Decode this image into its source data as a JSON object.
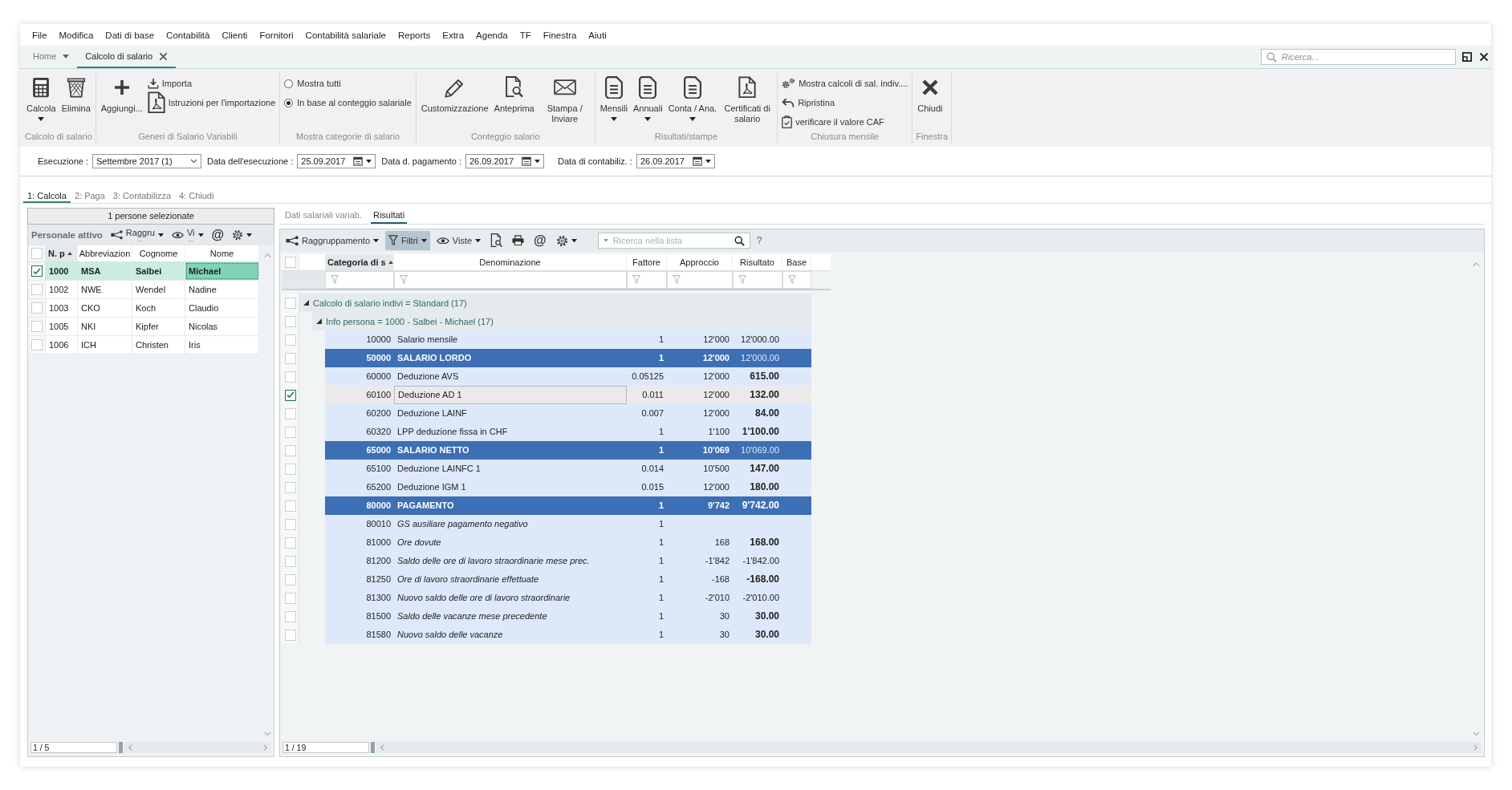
{
  "menu": [
    "File",
    "Modifica",
    "Dati di base",
    "Contabilità",
    "Clienti",
    "Fornitori",
    "Contabilità salariale",
    "Reports",
    "Extra",
    "Agenda",
    "TF",
    "Finestra",
    "Aiuti"
  ],
  "tabs": [
    {
      "label": "Home",
      "selected": false,
      "dropdown": true,
      "closable": false
    },
    {
      "label": "Calcolo di salario",
      "selected": true,
      "dropdown": false,
      "closable": true
    }
  ],
  "search": {
    "placeholder": "Ricerca..."
  },
  "ribbon": [
    {
      "title": "Calcolo di salario",
      "items": [
        {
          "kind": "large",
          "label": "Calcola",
          "dropdown": true
        },
        {
          "kind": "large",
          "label": "Elimina",
          "dropdown": false
        }
      ]
    },
    {
      "title": "Generi di Salario Variabili",
      "items": [
        {
          "kind": "large",
          "label": "Aggiungi...",
          "dropdown": false
        },
        {
          "kind": "small",
          "label": "Importa"
        },
        {
          "kind": "small",
          "label": "Istruzioni per l'importazione"
        }
      ]
    },
    {
      "title": "Mostra categorie di salario",
      "items": [
        {
          "kind": "radio",
          "label": "Mostra tutti",
          "selected": false
        },
        {
          "kind": "radio",
          "label": "In base al conteggio salariale",
          "selected": true
        }
      ]
    },
    {
      "title": "Conteggio salario",
      "items": [
        {
          "kind": "large",
          "label": "Customizzazione",
          "dropdown": false
        },
        {
          "kind": "large",
          "label": "Anteprima",
          "dropdown": false
        },
        {
          "kind": "large",
          "label": "Stampa / Inviare",
          "dropdown": false
        }
      ]
    },
    {
      "title": "Risultati/stampe",
      "items": [
        {
          "kind": "large",
          "label": "Mensili",
          "dropdown": true
        },
        {
          "kind": "large",
          "label": "Annuali",
          "dropdown": true
        },
        {
          "kind": "large",
          "label": "Conta / Ana.",
          "dropdown": true
        },
        {
          "kind": "large",
          "label": "Certificati di salario",
          "dropdown": false
        }
      ]
    },
    {
      "title": "Chiusura mensile",
      "items": [
        {
          "kind": "small",
          "label": "Mostra calcoli di sal. indiv...."
        },
        {
          "kind": "small",
          "label": "Ripristina"
        },
        {
          "kind": "small",
          "label": "verificare il valore CAF"
        }
      ]
    },
    {
      "title": "Finestra",
      "items": [
        {
          "kind": "large",
          "label": "Chiudi",
          "dropdown": false
        }
      ]
    }
  ],
  "run_fields": [
    {
      "kind": "select",
      "label": "Esecuzione :",
      "value": "Settembre 2017 (1)"
    },
    {
      "kind": "date",
      "label": "Data dell'esecuzione :",
      "value": "25.09.2017"
    },
    {
      "kind": "date",
      "label": "Data d. pagamento :",
      "value": "26.09.2017"
    },
    {
      "kind": "date",
      "label": "Data di contabiliz. :",
      "value": "26.09.2017"
    }
  ],
  "steps": [
    {
      "label": "1: Calcola",
      "selected": true
    },
    {
      "label": "2: Paga",
      "selected": false
    },
    {
      "label": "3: Contabilizza",
      "selected": false
    },
    {
      "label": "4: Chiudi",
      "selected": false
    }
  ],
  "people_panel": {
    "header": "1 persone selezionate",
    "title": "Personale attivo",
    "tools": [
      {
        "kind": "menu",
        "label": "Raggru",
        "more": "...",
        "dropdown": true
      },
      {
        "kind": "menu",
        "label": "Vi",
        "more": "...",
        "dropdown": true
      },
      {
        "kind": "glyph",
        "label": "@",
        "dropdown": false
      },
      {
        "kind": "icon",
        "dropdown": true
      }
    ],
    "all_checked": false,
    "columns": [
      {
        "label": "N. p",
        "sorted": true
      },
      {
        "label": "Abbreviazion",
        "sorted": false
      },
      {
        "label": "Cognome",
        "sorted": false
      },
      {
        "label": "Nome",
        "sorted": false
      }
    ],
    "rows": [
      {
        "number": "1000",
        "abbreviation": "MSA",
        "last_name": "Salbei",
        "first_name": "Michael",
        "checked": true,
        "selected": true
      },
      {
        "number": "1002",
        "abbreviation": "NWE",
        "last_name": "Wendel",
        "first_name": "Nadine",
        "checked": false,
        "selected": false
      },
      {
        "number": "1003",
        "abbreviation": "CKO",
        "last_name": "Koch",
        "first_name": "Claudio",
        "checked": false,
        "selected": false
      },
      {
        "number": "1005",
        "abbreviation": "NKI",
        "last_name": "Kipfer",
        "first_name": "Nicolas",
        "checked": false,
        "selected": false
      },
      {
        "number": "1006",
        "abbreviation": "ICH",
        "last_name": "Christen",
        "first_name": "Iris",
        "checked": false,
        "selected": false
      }
    ],
    "counter": "1 / 5"
  },
  "results_panel": {
    "subtabs": [
      {
        "label": "Dati salariali variab.",
        "selected": false
      },
      {
        "label": "Risultati",
        "selected": true
      }
    ],
    "toolbar": [
      {
        "kind": "menu",
        "label": "Raggruppamento",
        "dropdown": true,
        "pressed": false
      },
      {
        "kind": "menu",
        "label": "Filtri",
        "dropdown": true,
        "pressed": true
      },
      {
        "kind": "menu",
        "label": "Viste",
        "dropdown": true,
        "pressed": false
      },
      {
        "kind": "icon",
        "dropdown": false,
        "pressed": false
      },
      {
        "kind": "icon",
        "dropdown": false,
        "pressed": false
      },
      {
        "kind": "glyph",
        "label": "@",
        "dropdown": false,
        "pressed": false
      },
      {
        "kind": "icon",
        "dropdown": true,
        "pressed": false
      }
    ],
    "search": {
      "placeholder": "Ricerca nella lista"
    },
    "help": "?",
    "all_checked": false,
    "columns": [
      {
        "label": "Categoria di s",
        "sorted": true
      },
      {
        "label": "Denominazione",
        "sorted": false
      },
      {
        "label": "Fattore",
        "sorted": false
      },
      {
        "label": "Approccio",
        "sorted": false
      },
      {
        "label": "Risultato",
        "sorted": false
      },
      {
        "label": "Base",
        "sorted": false
      }
    ],
    "tree": [
      {
        "kind": "group",
        "label": "Calcolo di salario indivi = Standard (17)",
        "expanded": true,
        "checked": false,
        "children": [
          {
            "kind": "group",
            "label": "Info persona = 1000 - Salbei - Michael (17)",
            "expanded": true,
            "checked": false,
            "children": [
              {
                "kind": "line",
                "code": "10000",
                "name": "Salario mensile",
                "fattore": "1",
                "approccio": "12'000",
                "risultato": "12'000.00",
                "result_bold": false,
                "italic": false,
                "checked": false,
                "selected": false
              },
              {
                "kind": "total",
                "code": "50000",
                "name": "SALARIO LORDO",
                "fattore": "1",
                "approccio": "12'000",
                "risultato": "12'000.00",
                "result_bold": false,
                "italic": false,
                "checked": false,
                "selected": false
              },
              {
                "kind": "line",
                "code": "60000",
                "name": "Deduzione AVS",
                "fattore": "0.05125",
                "approccio": "12'000",
                "risultato": "615.00",
                "result_bold": true,
                "italic": false,
                "checked": false,
                "selected": false
              },
              {
                "kind": "line",
                "code": "60100",
                "name": "Deduzione AD 1",
                "fattore": "0.011",
                "approccio": "12'000",
                "risultato": "132.00",
                "result_bold": true,
                "italic": false,
                "checked": true,
                "selected": true
              },
              {
                "kind": "line",
                "code": "60200",
                "name": "Deduzione LAINF",
                "fattore": "0.007",
                "approccio": "12'000",
                "risultato": "84.00",
                "result_bold": true,
                "italic": false,
                "checked": false,
                "selected": false
              },
              {
                "kind": "line",
                "code": "60320",
                "name": "LPP deduzione fissa in CHF",
                "fattore": "1",
                "approccio": "1'100",
                "risultato": "1'100.00",
                "result_bold": true,
                "italic": false,
                "checked": false,
                "selected": false
              },
              {
                "kind": "total",
                "code": "65000",
                "name": "SALARIO NETTO",
                "fattore": "1",
                "approccio": "10'069",
                "risultato": "10'069.00",
                "result_bold": false,
                "italic": false,
                "checked": false,
                "selected": false
              },
              {
                "kind": "line",
                "code": "65100",
                "name": "Deduzione LAINFC 1",
                "fattore": "0.014",
                "approccio": "10'500",
                "risultato": "147.00",
                "result_bold": true,
                "italic": false,
                "checked": false,
                "selected": false
              },
              {
                "kind": "line",
                "code": "65200",
                "name": "Deduzione IGM 1",
                "fattore": "0.015",
                "approccio": "12'000",
                "risultato": "180.00",
                "result_bold": true,
                "italic": false,
                "checked": false,
                "selected": false
              },
              {
                "kind": "total",
                "code": "80000",
                "name": "PAGAMENTO",
                "fattore": "1",
                "approccio": "9'742",
                "risultato": "9'742.00",
                "result_bold": true,
                "italic": false,
                "checked": false,
                "selected": false
              },
              {
                "kind": "line",
                "code": "80010",
                "name": "GS ausiliare pagamento negativo",
                "fattore": "1",
                "italic": true,
                "checked": false,
                "selected": false
              },
              {
                "kind": "line",
                "code": "81000",
                "name": "Ore dovute",
                "fattore": "1",
                "approccio": "168",
                "risultato": "168.00",
                "result_bold": true,
                "italic": true,
                "checked": false,
                "selected": false
              },
              {
                "kind": "line",
                "code": "81200",
                "name": "Saldo delle ore di lavoro straordinarie mese prec.",
                "fattore": "1",
                "approccio": "-1'842",
                "risultato": "-1'842.00",
                "result_bold": false,
                "italic": true,
                "checked": false,
                "selected": false
              },
              {
                "kind": "line",
                "code": "81250",
                "name": "Ore di lavoro straordinarie effettuate",
                "fattore": "1",
                "approccio": "-168",
                "risultato": "-168.00",
                "result_bold": true,
                "italic": true,
                "checked": false,
                "selected": false
              },
              {
                "kind": "line",
                "code": "81300",
                "name": "Nuovo saldo delle ore di lavoro straordinarie",
                "fattore": "1",
                "approccio": "-2'010",
                "risultato": "-2'010.00",
                "result_bold": false,
                "italic": true,
                "checked": false,
                "selected": false
              },
              {
                "kind": "line",
                "code": "81500",
                "name": "Saldo delle vacanze mese precedente",
                "fattore": "1",
                "approccio": "30",
                "risultato": "30.00",
                "result_bold": true,
                "italic": true,
                "checked": false,
                "selected": false
              },
              {
                "kind": "line",
                "code": "81580",
                "name": "Nuovo saldo delle vacanze",
                "fattore": "1",
                "approccio": "30",
                "risultato": "30.00",
                "result_bold": true,
                "italic": true,
                "checked": false,
                "selected": false
              }
            ]
          }
        ]
      }
    ],
    "counter": "1 / 19"
  }
}
